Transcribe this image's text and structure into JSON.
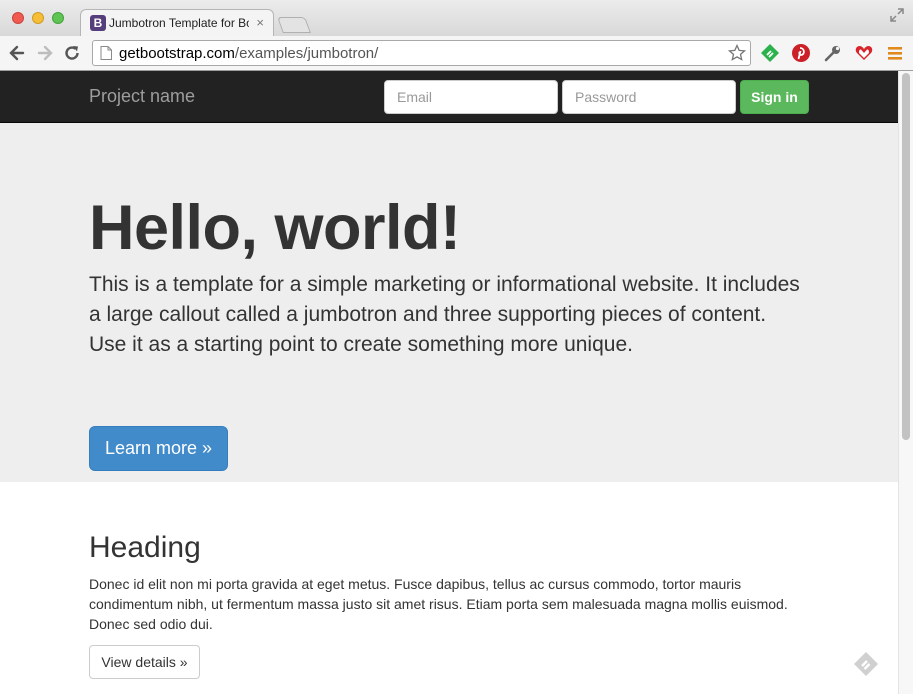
{
  "browser": {
    "tab": {
      "favicon_letter": "B",
      "title": "Jumbotron Template for Bootstrap",
      "close_glyph": "×"
    },
    "address": {
      "host": "getbootstrap.com",
      "path": "/examples/jumbotron/"
    },
    "icons": [
      "back-arrow-icon",
      "forward-arrow-icon",
      "reload-icon",
      "page-icon",
      "star-icon",
      "feedly-icon",
      "pinterest-icon",
      "wrench-icon",
      "heart-icon",
      "menu-icon",
      "fullscreen-icon"
    ],
    "colors": {
      "chrome_bg": "#d8d8d8",
      "menu_icon": "#e08a1e"
    }
  },
  "navbar": {
    "brand": "Project name",
    "email_placeholder": "Email",
    "password_placeholder": "Password",
    "signin_label": "Sign in",
    "colors": {
      "bg": "#222222",
      "brand": "#9d9d9d",
      "signin": "#5cb85c"
    }
  },
  "jumbotron": {
    "title": "Hello, world!",
    "lead": "This is a template for a simple marketing or informational website. It includes a large callout called a jumbotron and three supporting pieces of content. Use it as a starting point to create something more unique.",
    "button_label": "Learn more »",
    "colors": {
      "bg": "#eeeeee",
      "button": "#428bca"
    }
  },
  "content": {
    "heading": "Heading",
    "body": "Donec id elit non mi porta gravida at eget metus. Fusce dapibus, tellus ac cursus commodo, tortor mauris condimentum nibh, ut fermentum massa justo sit amet risus. Etiam porta sem malesuada magna mollis euismod. Donec sed odio dui.",
    "button_label": "View details »"
  }
}
